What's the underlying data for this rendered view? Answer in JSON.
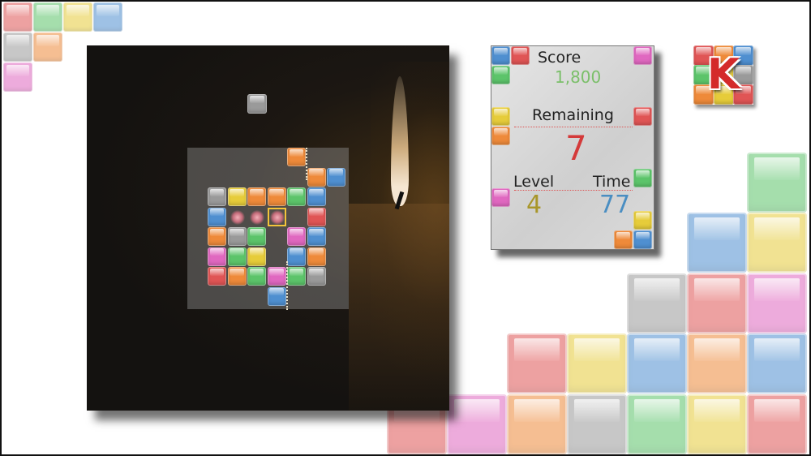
{
  "colors": {
    "red": "#e05555",
    "green": "#5cc46a",
    "yellow": "#e6cc3a",
    "blue": "#4f8fd0",
    "gray": "#9a9a9a",
    "orange": "#ee8a3a",
    "pink": "#e068c0",
    "score_value": "#7bbf6a",
    "remaining_value": "#d43a3a",
    "level_value": "#a8962a",
    "time_value": "#4a8ec2"
  },
  "hud": {
    "score_label": "Score",
    "score_value": "1,800",
    "remaining_label": "Remaining",
    "remaining_value": "7",
    "level_label": "Level",
    "level_value": "4",
    "time_label": "Time",
    "time_value": "77"
  },
  "logo": {
    "letter": "K",
    "icon": "k-logo-icon"
  },
  "board": {
    "falling_piece": "gray",
    "grid_rows": [
      [
        "",
        "",
        "",
        "",
        "orange",
        "",
        ""
      ],
      [
        "",
        "",
        "",
        "",
        "",
        "orange",
        "blue"
      ],
      [
        "gray",
        "yellow",
        "orange",
        "orange",
        "green",
        "blue",
        ""
      ],
      [
        "blue",
        "cleared",
        "cleared",
        "cursor",
        "",
        "red",
        ""
      ],
      [
        "orange",
        "gray",
        "green",
        "",
        "pink",
        "blue",
        ""
      ],
      [
        "pink",
        "green",
        "yellow",
        "",
        "blue",
        "orange",
        ""
      ],
      [
        "red",
        "orange",
        "green",
        "pink",
        "green",
        "gray",
        ""
      ],
      [
        "",
        "",
        "",
        "blue",
        "",
        "",
        ""
      ]
    ]
  }
}
